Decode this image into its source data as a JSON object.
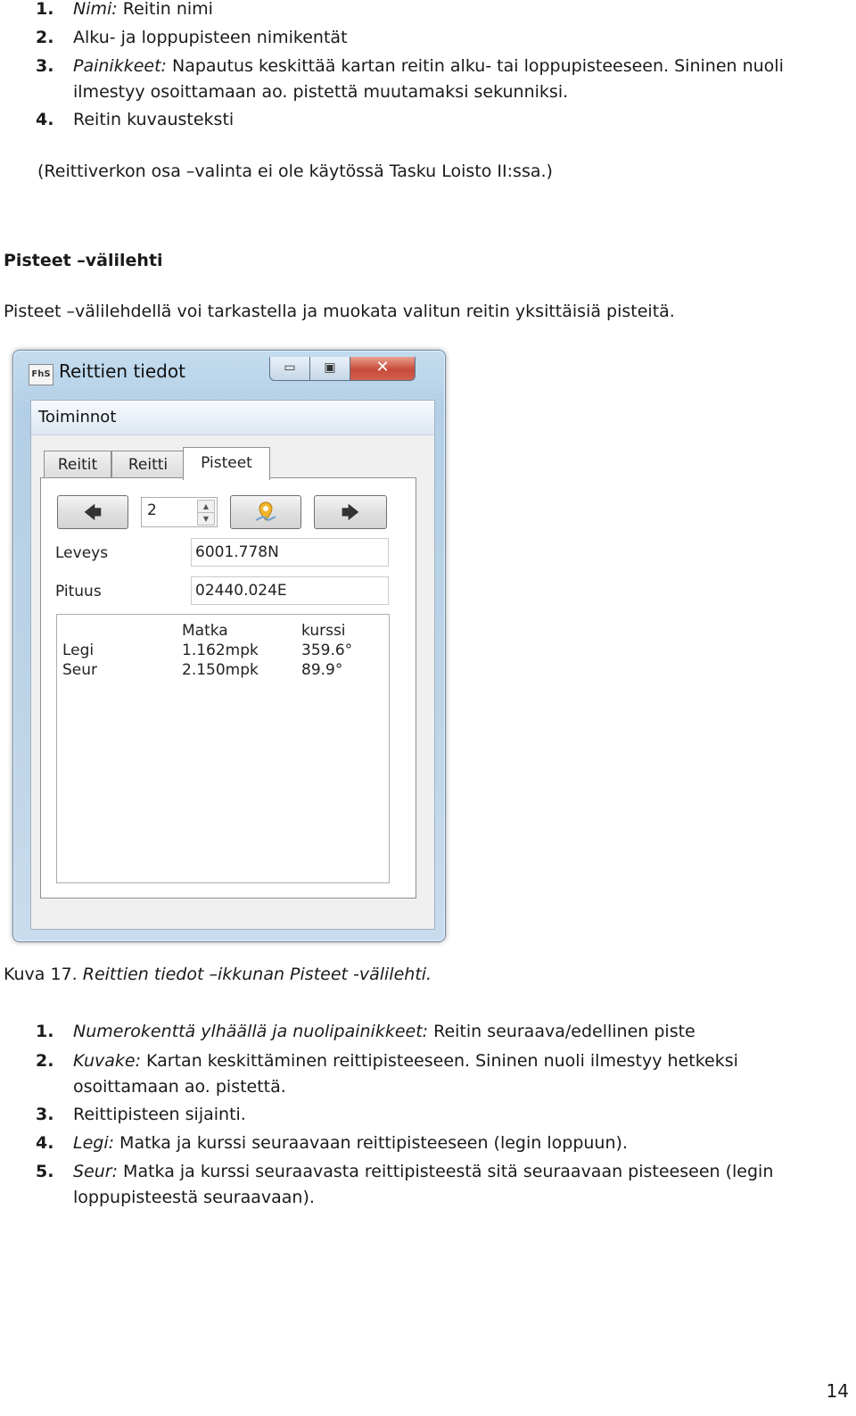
{
  "top_list": [
    {
      "num": "1.",
      "label": "Nimi:",
      "text": " Reitin nimi"
    },
    {
      "num": "2.",
      "label": "",
      "text": "Alku- ja loppupisteen nimikentät"
    },
    {
      "num": "3.",
      "label": "Painikkeet:",
      "text": " Napautus keskittää kartan reitin alku- tai loppupisteeseen. Sininen nuoli ilmestyy osoittamaan ao. pistettä muutamaksi sekunniksi."
    },
    {
      "num": "4.",
      "label": "",
      "text": "Reitin kuvausteksti"
    }
  ],
  "top_note": "(Reittiverkon osa –valinta ei ole käytössä Tasku Loisto II:ssa.)",
  "section_heading": "Pisteet –välilehti",
  "section_intro": "Pisteet –välilehdellä voi tarkastella ja muokata valitun reitin yksittäisiä pisteitä.",
  "window": {
    "icon_text": "FhS",
    "title": "Reittien tiedot",
    "min_glyph": "▭",
    "max_glyph": "▣",
    "close_glyph": "✕",
    "menu": "Toiminnot",
    "tabs": [
      "Reitit",
      "Reitti",
      "Pisteet"
    ],
    "point_number": "2",
    "prev_arrow": "🡄",
    "next_arrow": "🡆",
    "center_icon": "map-pin-icon",
    "lat_label": "Leveys",
    "lat_value": "6001.778N",
    "lon_label": "Pituus",
    "lon_value": "02440.024E",
    "info": {
      "col_distance": "Matka",
      "col_course": "kurssi",
      "rows": [
        {
          "label": "Legi",
          "distance": "1.162mpk",
          "course": "359.6°"
        },
        {
          "label": "Seur",
          "distance": "2.150mpk",
          "course": "89.9°"
        }
      ]
    }
  },
  "caption": {
    "prefix": "Kuva 17. ",
    "text": "Reittien tiedot –ikkunan Pisteet -välilehti."
  },
  "bottom_list": [
    {
      "num": "1.",
      "label": "Numerokenttä ylhäällä ja nuolipainikkeet:",
      "text": " Reitin seuraava/edellinen piste"
    },
    {
      "num": "2.",
      "label": "Kuvake:",
      "text": " Kartan keskittäminen reittipisteeseen. Sininen nuoli ilmestyy hetkeksi osoittamaan ao. pistettä."
    },
    {
      "num": "3.",
      "label": "",
      "text": "Reittipisteen sijainti."
    },
    {
      "num": "4.",
      "label": "Legi:",
      "text": " Matka ja kurssi seuraavaan reittipisteeseen (legin loppuun)."
    },
    {
      "num": "5.",
      "label": "Seur:",
      "text": " Matka ja kurssi seuraavasta reittipisteestä sitä seuraavaan pisteeseen (legin loppupisteestä seuraavaan)."
    }
  ],
  "page_number": "14"
}
